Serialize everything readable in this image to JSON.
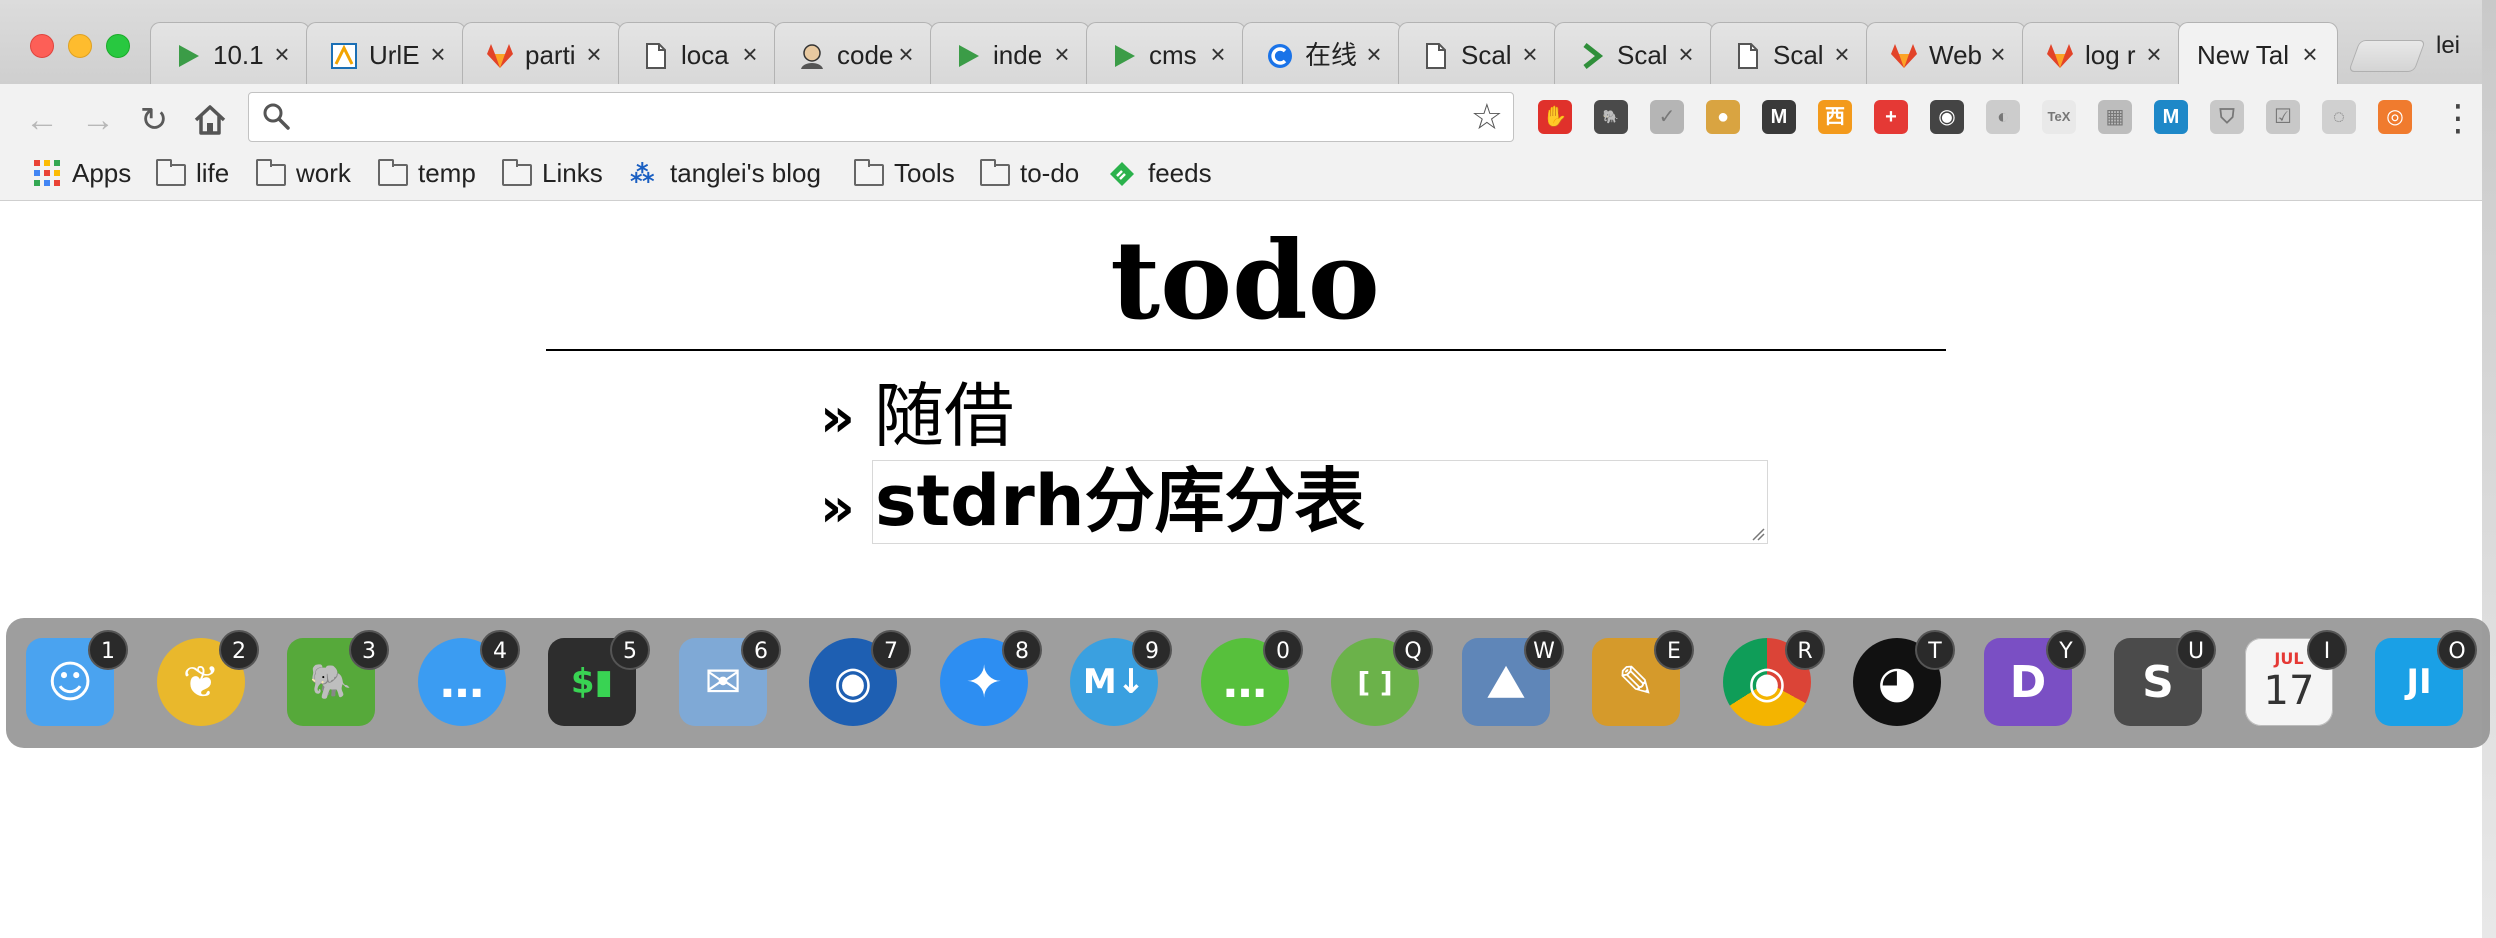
{
  "browser": {
    "tabs": [
      {
        "title": "10.1",
        "icon": "green-play-icon",
        "active": false
      },
      {
        "title": "UrlE",
        "icon": "urle-icon",
        "active": false
      },
      {
        "title": "parti",
        "icon": "gitlab-icon",
        "active": false
      },
      {
        "title": "loca",
        "icon": "page-icon",
        "active": false
      },
      {
        "title": "code",
        "icon": "avatar-icon",
        "active": false
      },
      {
        "title": "inde",
        "icon": "green-play-icon",
        "active": false
      },
      {
        "title": "cms",
        "icon": "green-play-icon",
        "active": false
      },
      {
        "title": "在线",
        "icon": "blue-c-icon",
        "active": false
      },
      {
        "title": "Scal",
        "icon": "page-icon",
        "active": false
      },
      {
        "title": "Scal",
        "icon": "green-chevron-icon",
        "active": false
      },
      {
        "title": "Scal",
        "icon": "page-icon",
        "active": false
      },
      {
        "title": "Web",
        "icon": "gitlab-icon",
        "active": false
      },
      {
        "title": "log r",
        "icon": "gitlab-icon",
        "active": false
      },
      {
        "title": "New Tal",
        "icon": "",
        "active": true
      }
    ],
    "profile_name": "lei",
    "omnibox": {
      "value": "",
      "placeholder": ""
    },
    "bookmarks": [
      {
        "label": "Apps",
        "icon": "apps-grid-icon"
      },
      {
        "label": "life",
        "icon": "folder-icon"
      },
      {
        "label": "work",
        "icon": "folder-icon"
      },
      {
        "label": "temp",
        "icon": "folder-icon"
      },
      {
        "label": "Links",
        "icon": "folder-icon"
      },
      {
        "label": "tanglei's blog",
        "icon": "blog-icon"
      },
      {
        "label": "Tools",
        "icon": "folder-icon"
      },
      {
        "label": "to-do",
        "icon": "folder-icon"
      },
      {
        "label": "feeds",
        "icon": "feedly-icon"
      }
    ],
    "extensions": [
      {
        "name": "adblock-icon",
        "color": "#e0312b",
        "glyph": "✋"
      },
      {
        "name": "evernote-icon",
        "color": "#4a4a4a",
        "glyph": "🐘"
      },
      {
        "name": "check-circle-icon",
        "color": "#b5b5b5",
        "glyph": "✓"
      },
      {
        "name": "cookie-icon",
        "color": "#d9a441",
        "glyph": "●"
      },
      {
        "name": "pocket-icon",
        "color": "#3a3a3a",
        "glyph": "M"
      },
      {
        "name": "translate-icon",
        "color": "#f39a1c",
        "glyph": "西"
      },
      {
        "name": "red-cross-icon",
        "color": "#e53935",
        "glyph": "+"
      },
      {
        "name": "camera-icon",
        "color": "#444444",
        "glyph": "◉"
      },
      {
        "name": "gray-globe-icon",
        "color": "#cccccc",
        "glyph": "◐"
      },
      {
        "name": "tex-icon",
        "color": "#e9e9e9",
        "glyph": "TeX"
      },
      {
        "name": "qr-icon",
        "color": "#bdbdbd",
        "glyph": "▦"
      },
      {
        "name": "m-icon",
        "color": "#1e88c8",
        "glyph": "M"
      },
      {
        "name": "shield-icon",
        "color": "#c8c8c8",
        "glyph": "⛉"
      },
      {
        "name": "checkbox-icon",
        "color": "#c8c8c8",
        "glyph": "☑"
      },
      {
        "name": "gray-swirl-icon",
        "color": "#d0d0d0",
        "glyph": "◌"
      },
      {
        "name": "orange-help-icon",
        "color": "#f07b2e",
        "glyph": "◎"
      }
    ]
  },
  "page": {
    "title": "todo",
    "items": [
      {
        "bullet": "»",
        "text": "随借"
      },
      {
        "bullet": "»",
        "text": "stdrh分库分表",
        "editing": true
      }
    ]
  },
  "dock": [
    {
      "name": "finder-icon",
      "key": "1",
      "color": "#4aa3f0",
      "glyph": "☺"
    },
    {
      "name": "gold-app-icon",
      "key": "2",
      "color": "#e9b82c",
      "glyph": "❦"
    },
    {
      "name": "evernote-dock-icon",
      "key": "3",
      "color": "#56a93a",
      "glyph": "🐘"
    },
    {
      "name": "messages-icon",
      "key": "4",
      "color": "#3b9cf2",
      "glyph": "…"
    },
    {
      "name": "terminal-icon",
      "key": "5",
      "color": "#2d2d2d",
      "glyph": "$▮"
    },
    {
      "name": "mail-stamp-icon",
      "key": "6",
      "color": "#7fa9d6",
      "glyph": "✉"
    },
    {
      "name": "globe-app-icon",
      "key": "7",
      "color": "#1e5fb2",
      "glyph": "◉"
    },
    {
      "name": "safari-icon",
      "key": "8",
      "color": "#2d8ef2",
      "glyph": "✦"
    },
    {
      "name": "markdown-icon",
      "key": "9",
      "color": "#3aa0e0",
      "glyph": "M↓"
    },
    {
      "name": "wechat-icon",
      "key": "0",
      "color": "#57c03c",
      "glyph": "…"
    },
    {
      "name": "brackets-icon",
      "key": "Q",
      "color": "#6bb24a",
      "glyph": "[ ]"
    },
    {
      "name": "preview-icon",
      "key": "W",
      "color": "#5f86b8",
      "glyph": "⛰"
    },
    {
      "name": "paint-icon",
      "key": "E",
      "color": "#d59a2b",
      "glyph": "✎"
    },
    {
      "name": "chrome-icon",
      "key": "R",
      "color": "#db4437",
      "glyph": "◉"
    },
    {
      "name": "qq-icon",
      "key": "T",
      "color": "#111111",
      "glyph": "◕"
    },
    {
      "name": "dash-icon",
      "key": "Y",
      "color": "#7a4fc4",
      "glyph": "D"
    },
    {
      "name": "sublime-icon",
      "key": "U",
      "color": "#4b4b4b",
      "glyph": "S"
    },
    {
      "name": "calendar-icon",
      "key": "I",
      "color": "#f5f5f5",
      "glyph": "17",
      "month": "JUL"
    },
    {
      "name": "jetbrains-icon",
      "key": "O",
      "color": "#1aa0e6",
      "glyph": "JI"
    }
  ]
}
